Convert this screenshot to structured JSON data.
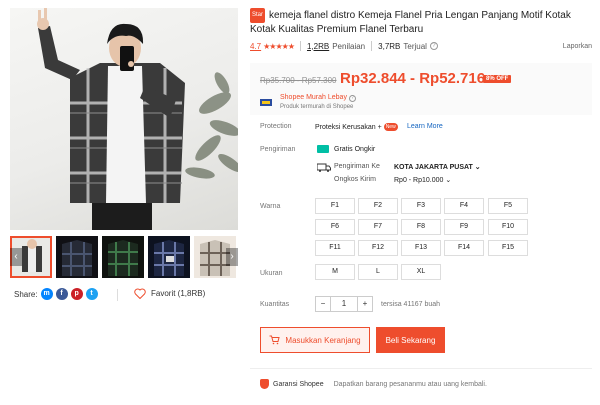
{
  "product": {
    "badge": "Star",
    "title": "kemeja flanel distro Kemeja Flanel Pria Lengan Panjang Motif Kotak Kotak Kualitas Premium Flanel Terbaru",
    "rating": "4.7",
    "stars": 5,
    "rating_count": "1,2RB",
    "rating_label": "Penilaian",
    "sold_count": "3,7RB",
    "sold_label": "Terjual",
    "report_label": "Laporkan"
  },
  "price": {
    "original": "Rp35.700 - Rp57.300",
    "current": "Rp32.844 - Rp52.716",
    "discount": "8% OFF",
    "promo_title": "Shopee Murah Lebay",
    "promo_subtitle": "Produk termurah di Shopee"
  },
  "protection": {
    "label": "Protection",
    "value": "Proteksi Kerusakan +",
    "badge": "New",
    "link": "Learn More"
  },
  "shipping": {
    "label": "Pengiriman",
    "free": "Gratis Ongkir",
    "to_label": "Pengiriman Ke",
    "to_value": "KOTA JAKARTA PUSAT",
    "cost_label": "Ongkos Kirim",
    "cost_value": "Rp0 - Rp10.000"
  },
  "variants": {
    "color_label": "Warna",
    "colors": [
      "F1",
      "F2",
      "F3",
      "F4",
      "F5",
      "F6",
      "F7",
      "F8",
      "F9",
      "F10",
      "F11",
      "F12",
      "F13",
      "F14",
      "F15"
    ],
    "size_label": "Ukuran",
    "sizes": [
      "M",
      "L",
      "XL"
    ]
  },
  "quantity": {
    "label": "Kuantitas",
    "minus": "−",
    "value": "1",
    "plus": "+",
    "stock": "tersisa 41167 buah"
  },
  "actions": {
    "cart": "Masukkan Keranjang",
    "buy": "Beli Sekarang"
  },
  "guarantee": {
    "title": "Garansi Shopee",
    "desc": "Dapatkan barang pesananmu atau uang kembali."
  },
  "share": {
    "label": "Share:",
    "favorite": "Favorit (1,8RB)"
  },
  "colors": {
    "accent": "#ee4d2d",
    "link": "#1565c0"
  }
}
